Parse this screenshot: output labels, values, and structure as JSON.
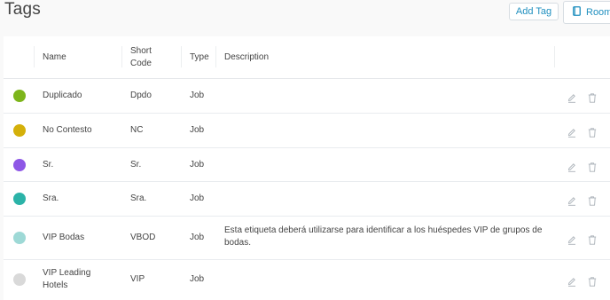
{
  "page": {
    "title": "Tags"
  },
  "toolbar": {
    "add_tag_label": "Add Tag",
    "rooms_label": "Rooms",
    "rooms_icon": "book-icon"
  },
  "table": {
    "headers": {
      "name": "Name",
      "short_code_line1": "Short",
      "short_code_line2": "Code",
      "type": "Type",
      "description": "Description"
    },
    "rows": [
      {
        "color": "#7db51b",
        "name": "Duplicado",
        "short_code": "Dpdo",
        "type": "Job",
        "description": ""
      },
      {
        "color": "#d4b00a",
        "name": "No Contesto",
        "short_code": "NC",
        "type": "Job",
        "description": ""
      },
      {
        "color": "#8e57e6",
        "name": "Sr.",
        "short_code": "Sr.",
        "type": "Job",
        "description": ""
      },
      {
        "color": "#2bb3a8",
        "name": "Sra.",
        "short_code": "Sra.",
        "type": "Job",
        "description": ""
      },
      {
        "color": "#9ed9d6",
        "name": "VIP Bodas",
        "short_code": "VBOD",
        "type": "Job",
        "description_line1": "Esta etiqueta deberá utilizarse para identificar a los huéspedes VIP de grupos de",
        "description_line2": "bodas."
      },
      {
        "color": "#d9d9d9",
        "name_line1": "VIP Leading",
        "name_line2": "Hotels",
        "short_code": "VIP",
        "type": "Job",
        "description": ""
      }
    ],
    "row_action_icons": [
      "pencil-icon",
      "trash-icon"
    ]
  }
}
